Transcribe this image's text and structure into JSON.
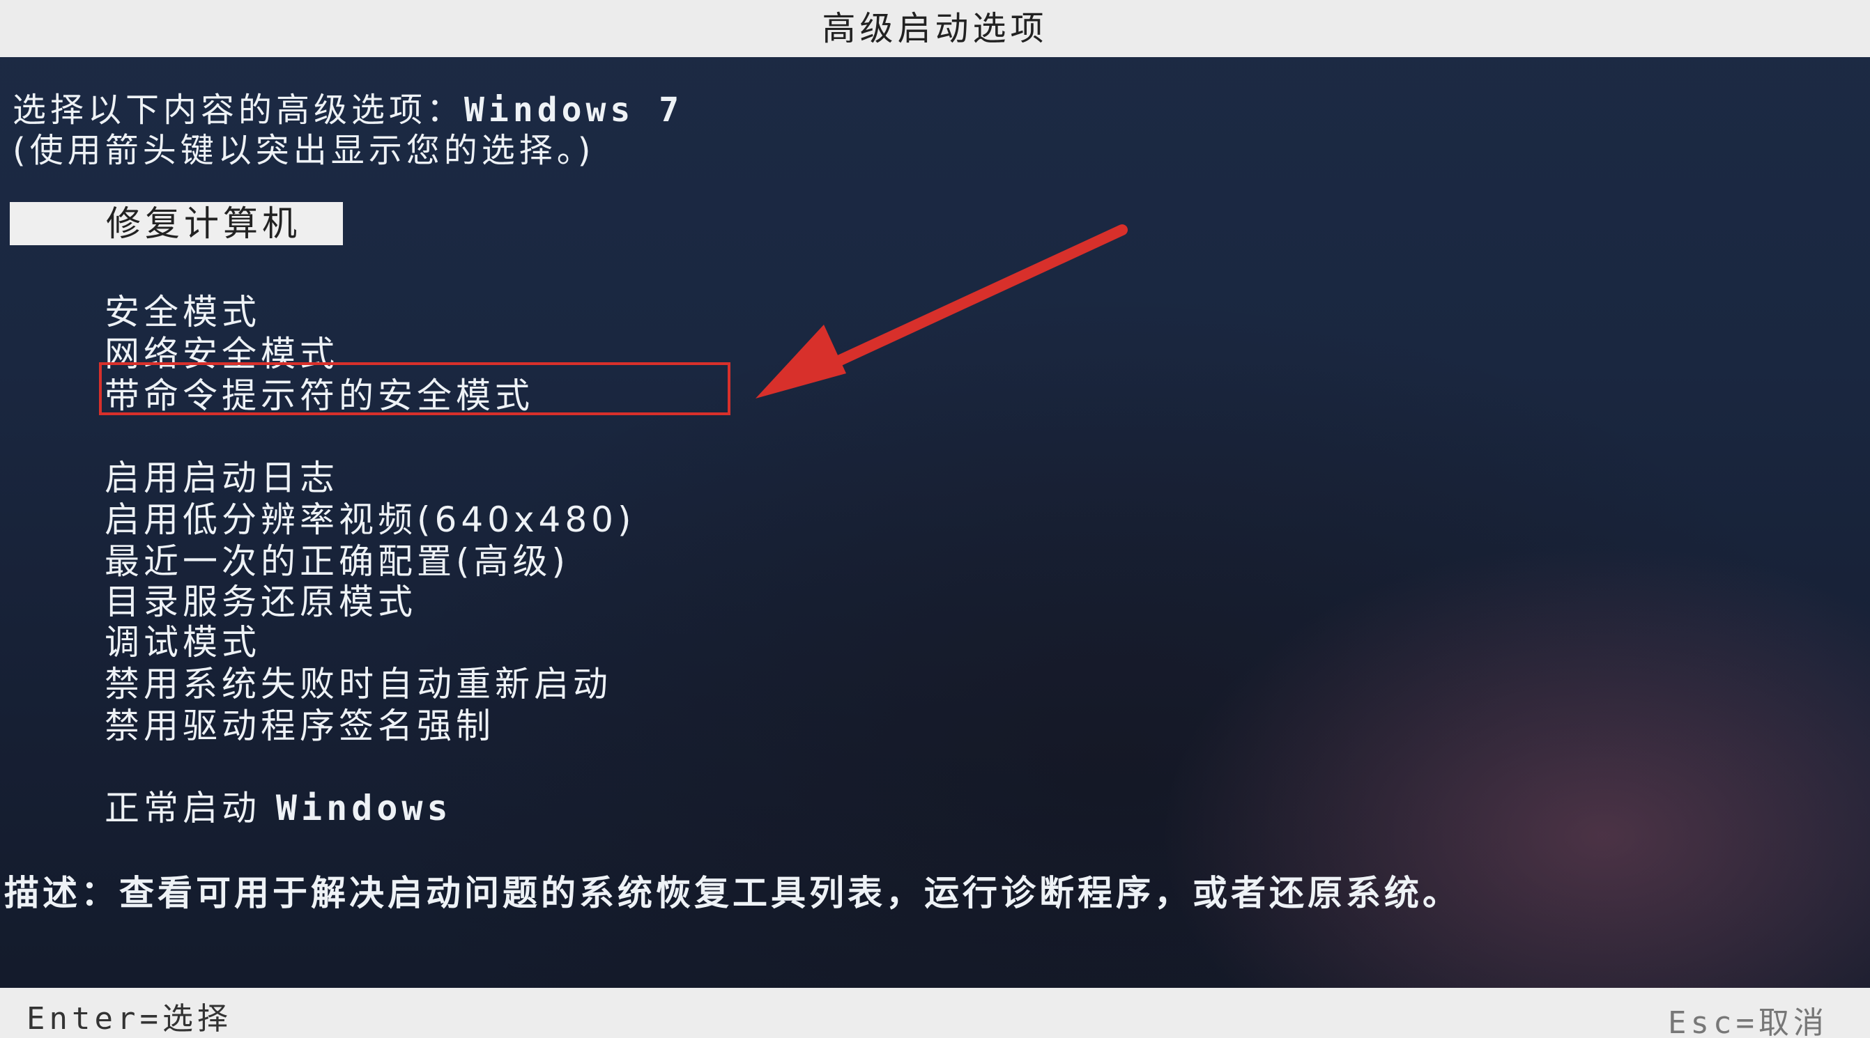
{
  "window": {
    "title": "高级启动选项"
  },
  "prompt": {
    "line1_prefix": "选择以下内容的高级选项：",
    "line1_os": "Windows 7",
    "line2": "(使用箭头键以突出显示您的选择。)"
  },
  "menu": {
    "items": [
      {
        "label": "修复计算机",
        "selected": true
      },
      {
        "label": "安全模式"
      },
      {
        "label": "网络安全模式"
      },
      {
        "label": "带命令提示符的安全模式",
        "annotated": true
      },
      {
        "label": "启用启动日志"
      },
      {
        "label": "启用低分辨率视频(640x480)"
      },
      {
        "label": "最近一次的正确配置(高级)"
      },
      {
        "label": "目录服务还原模式"
      },
      {
        "label": "调试模式"
      },
      {
        "label": "禁用系统失败时自动重新启动"
      },
      {
        "label": "禁用驱动程序签名强制"
      },
      {
        "label_prefix": "正常启动",
        "label_suffix": "Windows"
      }
    ]
  },
  "description": {
    "text": "描述：查看可用于解决启动问题的系统恢复工具列表，运行诊断程序，或者还原系统。"
  },
  "footer": {
    "enter_key": "Enter=",
    "enter_action": "选择",
    "esc_key": "Esc=",
    "esc_action": "取消"
  },
  "colors": {
    "background": "#1a2740",
    "bar": "#ececec",
    "annotation": "#d8302b"
  }
}
